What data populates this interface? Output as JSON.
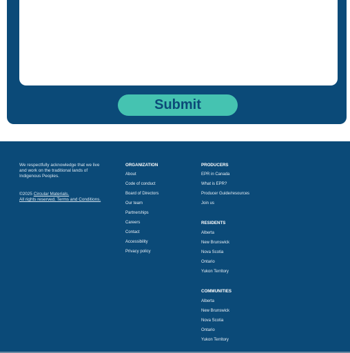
{
  "form": {
    "submit_label": "Submit"
  },
  "footer": {
    "acknowledgement": "We respectfully acknowledge that we live and work on the traditional lands of Indigenous Peoples.",
    "copyright_prefix": "©2025 ",
    "copyright_link": "Circular Materials.",
    "rights_text": "All rights reserved. ",
    "terms_link": "Terms and Conditions.",
    "organization": {
      "heading": "ORGANIZATION",
      "items": [
        "About",
        "Code of conduct",
        "Board of Directors",
        "Our team",
        "Partnerships",
        "Careers",
        "Contact",
        "Accessibility",
        "Privacy policy"
      ]
    },
    "producers": {
      "heading": "PRODUCERS",
      "items": [
        "EPR in Canada",
        "What is EPR?",
        "Producer Guide/resources",
        "Join us"
      ]
    },
    "residents": {
      "heading": "RESIDENTS",
      "items": [
        "Alberta",
        "New Brunswick",
        "Nova Scotia",
        "Ontario",
        "Yukon Territory"
      ]
    },
    "communities": {
      "heading": "COMMUNITIES",
      "items": [
        "Alberta",
        "New Brunswick",
        "Nova Scotia",
        "Ontario",
        "Yukon Territory"
      ]
    }
  },
  "colors": {
    "brand_navy": "#0b4a78",
    "accent_teal": "#45c3b1"
  }
}
